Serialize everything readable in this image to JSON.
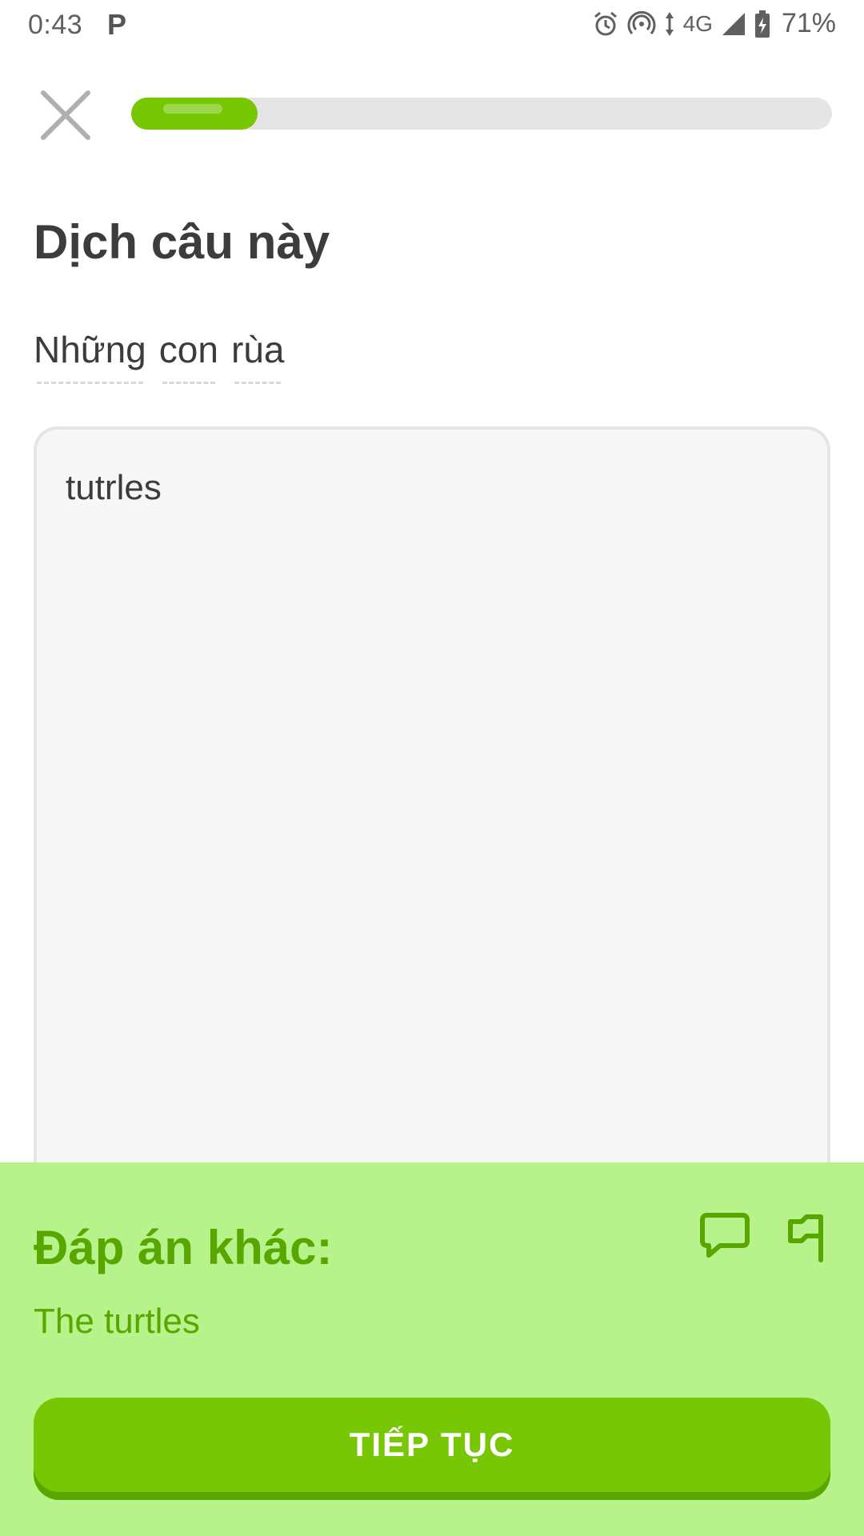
{
  "status_bar": {
    "time": "0:43",
    "app_indicator": "P",
    "network": "4G",
    "battery": "71%",
    "icons": [
      "alarm-icon",
      "hotspot-icon",
      "data-arrows-icon",
      "signal-icon",
      "battery-charging-icon"
    ]
  },
  "lesson": {
    "progress": 0.18,
    "close_icon": "close-icon"
  },
  "exercise": {
    "title": "Dịch câu này",
    "prompt_words": [
      "Những",
      "con",
      "rùa"
    ],
    "answer_text": "tutrles"
  },
  "feedback": {
    "title": "Đáp án khác:",
    "answer": "The turtles",
    "discuss_icon": "discuss-icon",
    "report_icon": "report-flag-icon",
    "continue_label": "TIẾP TỤC",
    "colors": {
      "panel_bg": "#b8f28b",
      "text": "#58a700",
      "button": "#77c704"
    }
  }
}
